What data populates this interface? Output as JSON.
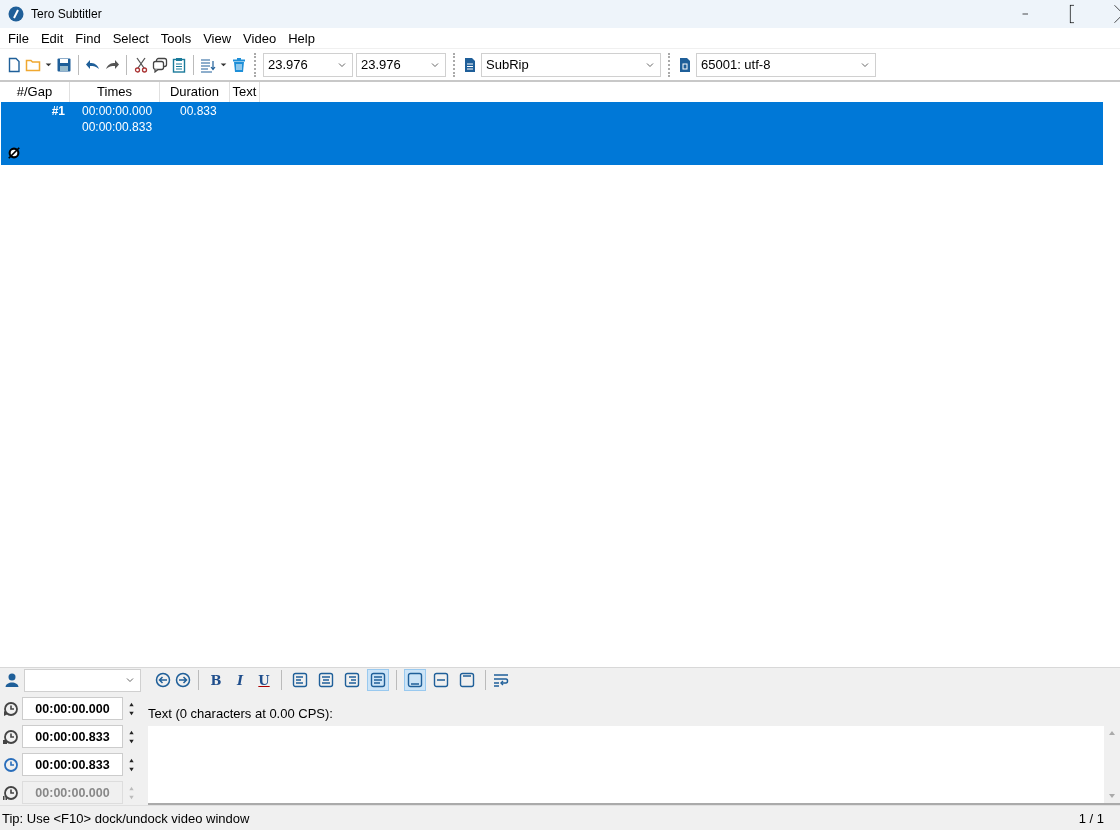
{
  "window": {
    "title": "Tero Subtitler"
  },
  "menu": [
    "File",
    "Edit",
    "Find",
    "Select",
    "Tools",
    "View",
    "Video",
    "Help"
  ],
  "toolbar": {
    "frame_rate_from": "23.976",
    "frame_rate_to": "23.976",
    "format": "SubRip",
    "encoding": "65001: utf-8"
  },
  "table": {
    "columns": [
      "#/Gap",
      "Times",
      "Duration",
      "Text"
    ],
    "rows": [
      {
        "number": "#1",
        "start": "00:00:00.000",
        "end": "00:00:00.833",
        "duration": "00.833",
        "text": "",
        "selected": true
      }
    ]
  },
  "editor": {
    "format_buttons": [
      "B",
      "I",
      "U"
    ],
    "alignment_buttons": [
      {
        "selected": false
      },
      {
        "selected": false
      },
      {
        "selected": false
      },
      {
        "selected": true
      }
    ],
    "position_buttons": [
      {
        "selected": true
      },
      {
        "selected": false
      },
      {
        "selected": false
      }
    ],
    "times": [
      {
        "kind": "start",
        "value": "00:00:00.000",
        "disabled": false
      },
      {
        "kind": "end",
        "value": "00:00:00.833",
        "disabled": false
      },
      {
        "kind": "duration",
        "value": "00:00:00.833",
        "disabled": false
      },
      {
        "kind": "pause",
        "value": "00:00:00.000",
        "disabled": true
      }
    ],
    "text_label": "Text (0 characters at 0.00 CPS):"
  },
  "status_bar": {
    "tip": "Tip: Use <F10> dock/undock video window",
    "position": "1 / 1"
  }
}
